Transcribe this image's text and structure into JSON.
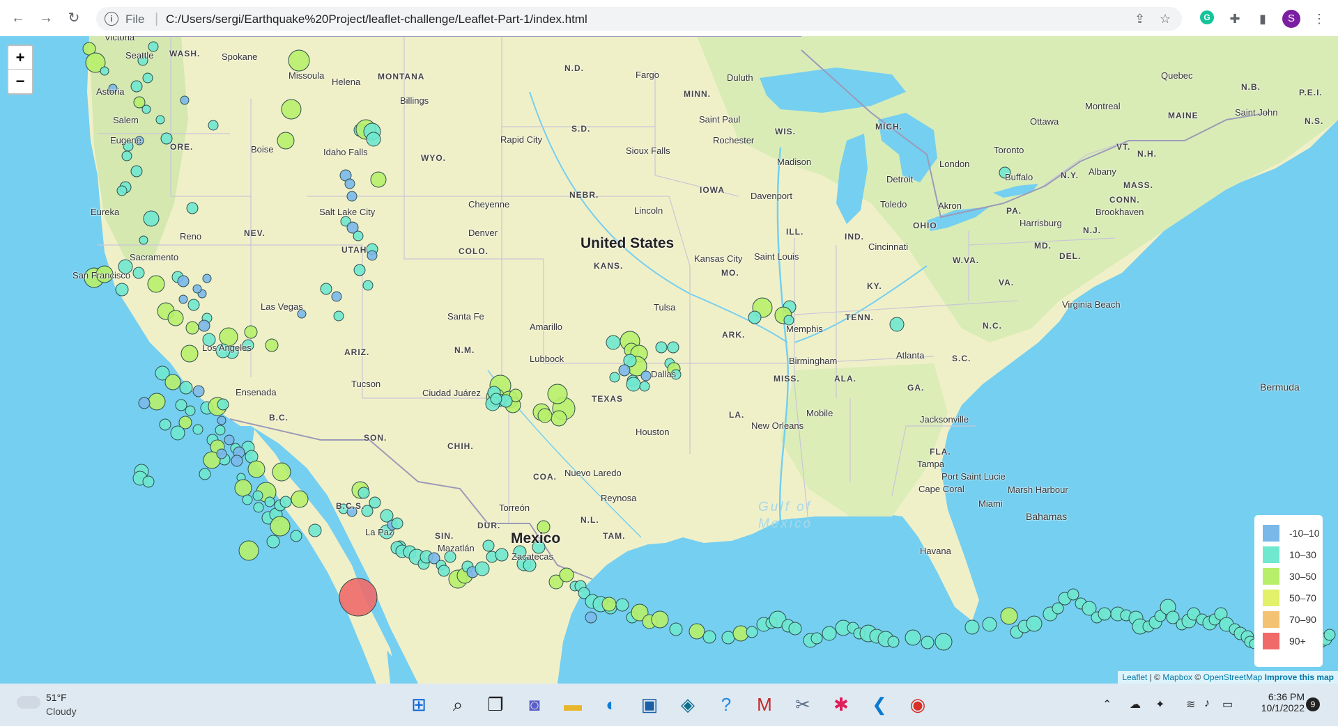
{
  "browser": {
    "file_label": "File",
    "url": "C:/Users/sergi/Earthquake%20Project/leaflet-challenge/Leaflet-Part-1/index.html",
    "profile_initial": "S"
  },
  "map": {
    "zoom_in": "+",
    "zoom_out": "−",
    "labels": {
      "country_us": "United States",
      "country_mexico": "Mexico",
      "gulf1": "Gulf of",
      "gulf2": "Mexico",
      "bermuda": "Bermuda",
      "bahamas": "Bahamas",
      "wash": "WASH.",
      "ore": "ORE.",
      "nev": "NEV.",
      "utah": "UTAH",
      "ariz": "ARIZ.",
      "nm": "N.M.",
      "colo": "COLO.",
      "wyo": "WYO.",
      "montana": "MONTANA",
      "nd": "N.D.",
      "sd": "S.D.",
      "nebr": "NEBR.",
      "kans": "KANS.",
      "texas": "TEXAS",
      "minn": "MINN.",
      "iowa": "IOWA",
      "mo": "MO.",
      "ark": "ARK.",
      "ill": "ILL.",
      "wis": "WIS.",
      "mich": "MICH.",
      "ind": "IND.",
      "ohio": "OHIO",
      "ky": "KY.",
      "tenn": "TENN.",
      "miss": "MISS.",
      "ala": "ALA.",
      "ga": "GA.",
      "la": "LA.",
      "fla": "FLA.",
      "sc": "S.C.",
      "nc": "N.C.",
      "va": "VA.",
      "wva": "W.VA.",
      "pa": "PA.",
      "ny": "N.Y.",
      "md": "MD.",
      "del": "DEL.",
      "nj": "N.J.",
      "conn": "CONN.",
      "mass": "MASS.",
      "vt": "VT.",
      "nh": "N.H.",
      "maine": "MAINE",
      "nb": "N.B.",
      "ns": "N.S.",
      "pei": "P.E.I.",
      "bc": "B.C.",
      "bcs": "B.C.S.",
      "son": "SON.",
      "chih": "CHIH.",
      "coa": "COA.",
      "nl": "N.L.",
      "tam": "TAM.",
      "dur": "DUR.",
      "sin": "SIN.",
      "victoria": "Victoria",
      "seattle": "Seattle",
      "spokane": "Spokane",
      "astoria": "Astoria",
      "salem": "Salem",
      "eugene": "Eugene",
      "boise": "Boise",
      "idaho_falls": "Idaho Falls",
      "missoula": "Missoula",
      "helena": "Helena",
      "billings": "Billings",
      "eureka": "Eureka",
      "reno": "Reno",
      "sacramento": "Sacramento",
      "san_francisco": "San Francisco",
      "las_vegas": "Las Vegas",
      "los_angeles": "Los Angeles",
      "ensenada": "Ensenada",
      "salt_lake": "Salt Lake City",
      "cheyenne": "Cheyenne",
      "denver": "Denver",
      "santa_fe": "Santa Fe",
      "tucson": "Tucson",
      "ciudad_juarez": "Ciudad Juárez",
      "amarillo": "Amarillo",
      "lubbock": "Lubbock",
      "dallas": "Dallas",
      "houston": "Houston",
      "tulsa": "Tulsa",
      "kansas_city": "Kansas City",
      "lincoln": "Lincoln",
      "sioux_falls": "Sioux Falls",
      "rapid_city": "Rapid City",
      "fargo": "Fargo",
      "duluth": "Duluth",
      "saint_paul": "Saint Paul",
      "rochester": "Rochester",
      "madison": "Madison",
      "davenport": "Davenport",
      "saint_louis": "Saint Louis",
      "memphis": "Memphis",
      "birmingham": "Birmingham",
      "atlanta": "Atlanta",
      "new_orleans": "New Orleans",
      "mobile": "Mobile",
      "jacksonville": "Jacksonville",
      "tampa": "Tampa",
      "port_saint_lucie": "Port Saint Lucie",
      "cape_coral": "Cape Coral",
      "miami": "Miami",
      "marsh_harbour": "Marsh Harbour",
      "havana": "Havana",
      "cincinnati": "Cincinnati",
      "detroit": "Detroit",
      "toledo": "Toledo",
      "akron": "Akron",
      "london": "London",
      "toronto": "Toronto",
      "buffalo": "Buffalo",
      "ottawa": "Ottawa",
      "montreal": "Montreal",
      "quebec": "Quebec",
      "albany": "Albany",
      "harrisburg": "Harrisburg",
      "brookhaven": "Brookhaven",
      "virginia_beach": "Virginia Beach",
      "saint_john": "Saint John",
      "nuevo_laredo": "Nuevo Laredo",
      "reynosa": "Reynosa",
      "torreon": "Torreón",
      "la_paz": "La Paz",
      "mazatlan": "Mazatlán",
      "zacatecas": "Zacatecas"
    },
    "legend": [
      {
        "label": "-10–10",
        "color": "#7ab8ea"
      },
      {
        "label": "10–30",
        "color": "#6fe8cf"
      },
      {
        "label": "30–50",
        "color": "#b7ef6a"
      },
      {
        "label": "50–70",
        "color": "#e2f06a"
      },
      {
        "label": "70–90",
        "color": "#f3c373"
      },
      {
        "label": "90+",
        "color": "#f06a6a"
      }
    ],
    "attribution": {
      "leaflet": "Leaflet",
      "sep": " | © ",
      "mapbox": "Mapbox",
      "copy": " © ",
      "osm": "OpenStreetMap",
      "improve": "Improve this map"
    }
  },
  "taskbar": {
    "weather_temp": "51°F",
    "weather_cond": "Cloudy",
    "time": "6:36 PM",
    "date": "10/1/2022",
    "notifications": "9"
  }
}
